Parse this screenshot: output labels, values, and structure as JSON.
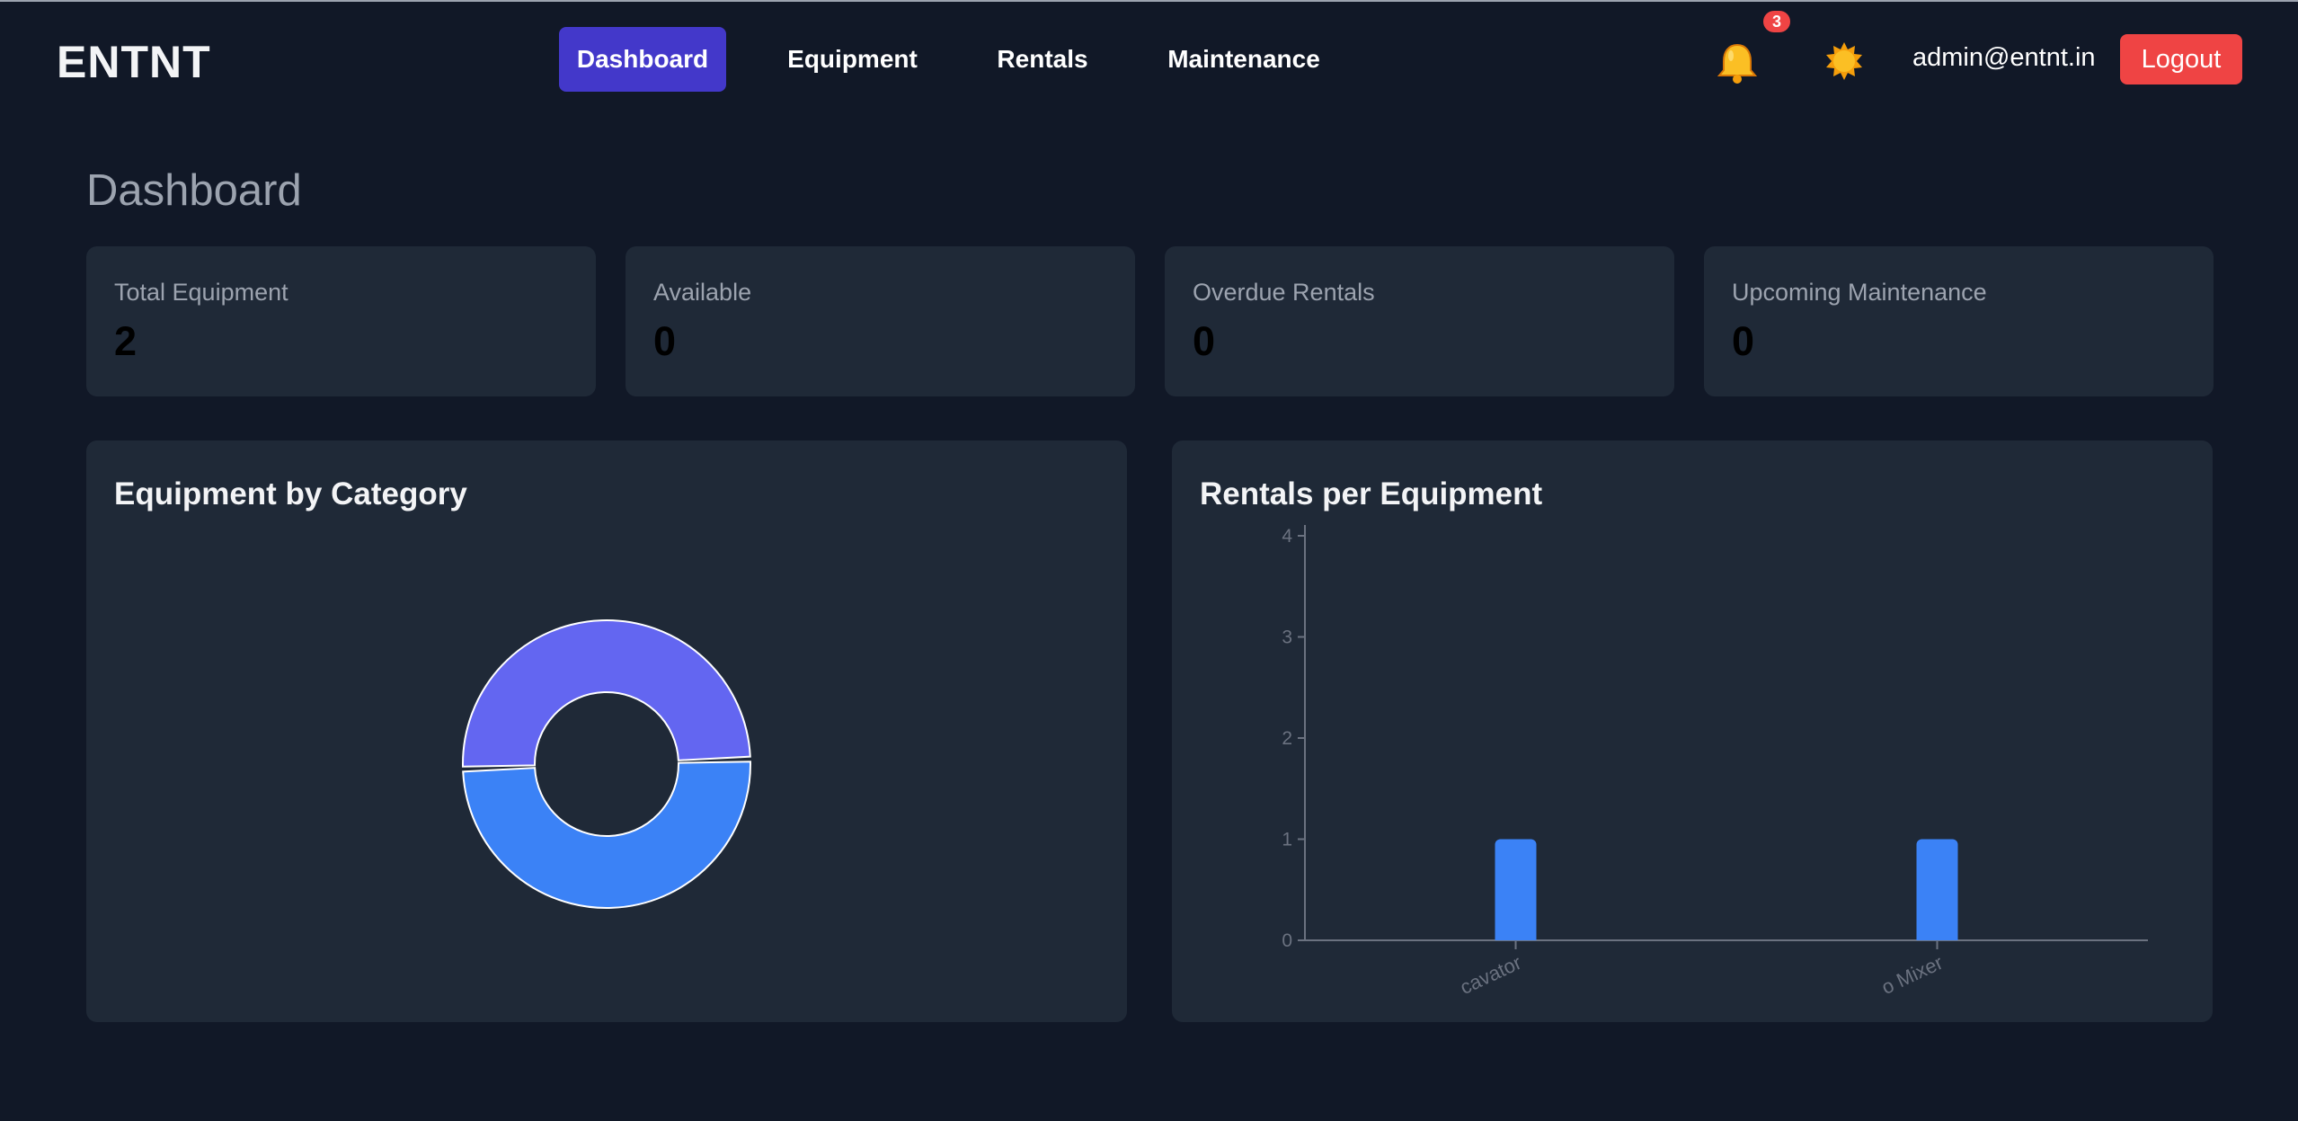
{
  "brand": "ENTNT",
  "nav": {
    "items": [
      {
        "label": "Dashboard",
        "active": true
      },
      {
        "label": "Equipment",
        "active": false
      },
      {
        "label": "Rentals",
        "active": false
      },
      {
        "label": "Maintenance",
        "active": false
      }
    ]
  },
  "header": {
    "notification_count": "3",
    "user_email": "admin@entnt.in",
    "logout_label": "Logout",
    "bell_icon": "bell-icon",
    "theme_icon": "sun-icon"
  },
  "page": {
    "title": "Dashboard"
  },
  "stats": [
    {
      "label": "Total Equipment",
      "value": "2"
    },
    {
      "label": "Available",
      "value": "0"
    },
    {
      "label": "Overdue Rentals",
      "value": "0"
    },
    {
      "label": "Upcoming Maintenance",
      "value": "0"
    }
  ],
  "charts": {
    "category_title": "Equipment by Category",
    "rentals_title": "Rentals per Equipment"
  },
  "colors": {
    "background": "#111827",
    "card": "#1f2937",
    "nav_active": "#4338ca",
    "logout": "#ef4444",
    "blue": "#3b82f6",
    "indigo": "#6366f1"
  },
  "chart_data": [
    {
      "type": "pie",
      "title": "Equipment by Category",
      "values": [
        1,
        1
      ],
      "colors": [
        "#3b82f6",
        "#6366f1"
      ]
    },
    {
      "type": "bar",
      "title": "Rentals per Equipment",
      "categories": [
        "cavator",
        "o Mixer"
      ],
      "values": [
        1,
        1
      ],
      "ylim": [
        0,
        4
      ],
      "yticks": [
        0,
        1,
        2,
        3,
        4
      ],
      "color": "#3b82f6",
      "grid": false
    }
  ]
}
